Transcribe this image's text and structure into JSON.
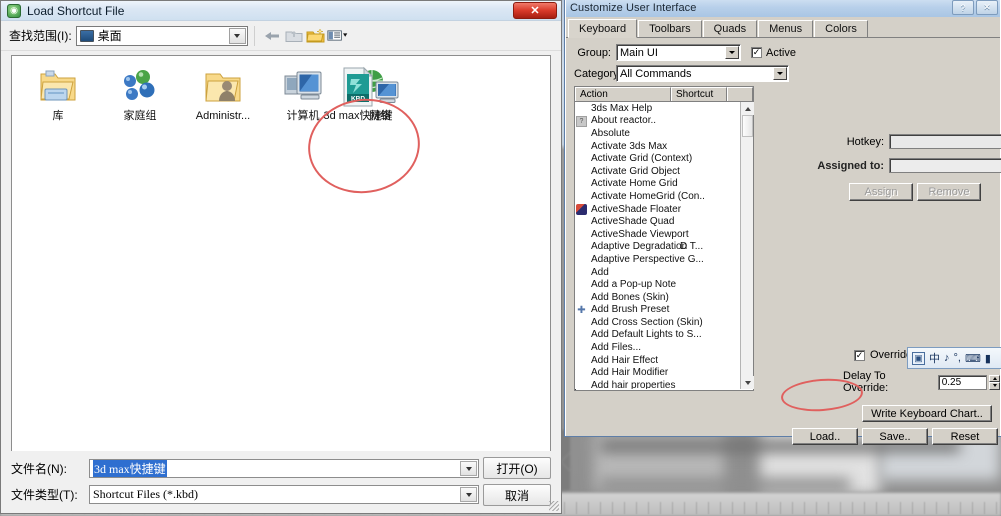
{
  "load_dialog": {
    "title": "Load Shortcut File",
    "title_icon": "max-app-icon",
    "close_label": "✕",
    "lookin_label": "查找范围(I):",
    "lookin_value": "桌面",
    "toolbar_icons": [
      "back-arrow-icon",
      "up-folder-icon",
      "new-folder-icon",
      "views-icon"
    ],
    "files": [
      {
        "label": "库",
        "icon": "library-folder-icon"
      },
      {
        "label": "家庭组",
        "icon": "homegroup-icon"
      },
      {
        "label": "Administr...",
        "icon": "user-folder-icon"
      },
      {
        "label": "计算机",
        "icon": "computer-icon"
      },
      {
        "label": "网络",
        "icon": "network-icon"
      },
      {
        "label": "3d max快捷键",
        "icon": "kbd-file-icon",
        "icon_text": "KBD"
      }
    ],
    "filename_label": "文件名(N):",
    "filename_value": "3d max快捷键",
    "filetype_label": "文件类型(T):",
    "filetype_value": "Shortcut Files (*.kbd)",
    "open_label": "打开(O)",
    "cancel_label": "取消"
  },
  "cui_window": {
    "title": "Customize User Interface",
    "help_label": "?",
    "close_label": "✕",
    "tabs": [
      {
        "label": "Keyboard",
        "active": true
      },
      {
        "label": "Toolbars",
        "active": false
      },
      {
        "label": "Quads",
        "active": false
      },
      {
        "label": "Menus",
        "active": false
      },
      {
        "label": "Colors",
        "active": false
      }
    ],
    "group_label": "Group:",
    "group_value": "Main UI",
    "active_checkbox_label": "Active",
    "active_checked": true,
    "category_label": "Category:",
    "category_value": "All Commands",
    "columns": {
      "action": "Action",
      "shortcut": "Shortcut"
    },
    "actions": [
      {
        "name": "3ds Max Help",
        "shortcut": "",
        "icon": ""
      },
      {
        "name": "About reactor..",
        "shortcut": "",
        "icon": "reactor"
      },
      {
        "name": "Absolute",
        "shortcut": "",
        "icon": ""
      },
      {
        "name": "Activate 3ds Max",
        "shortcut": "",
        "icon": ""
      },
      {
        "name": "Activate Grid (Context)",
        "shortcut": "",
        "icon": ""
      },
      {
        "name": "Activate Grid Object",
        "shortcut": "",
        "icon": ""
      },
      {
        "name": "Activate Home Grid",
        "shortcut": "",
        "icon": ""
      },
      {
        "name": "Activate HomeGrid (Con..",
        "shortcut": "",
        "icon": ""
      },
      {
        "name": "ActiveShade Floater",
        "shortcut": "",
        "icon": "shade"
      },
      {
        "name": "ActiveShade Quad",
        "shortcut": "",
        "icon": ""
      },
      {
        "name": "ActiveShade Viewport",
        "shortcut": "",
        "icon": ""
      },
      {
        "name": "Adaptive Degradation T...",
        "shortcut": "D",
        "icon": ""
      },
      {
        "name": "Adaptive Perspective G...",
        "shortcut": "",
        "icon": ""
      },
      {
        "name": "Add",
        "shortcut": "",
        "icon": ""
      },
      {
        "name": "Add a Pop-up Note",
        "shortcut": "",
        "icon": ""
      },
      {
        "name": "Add Bones (Skin)",
        "shortcut": "",
        "icon": ""
      },
      {
        "name": "Add Brush Preset",
        "shortcut": "",
        "icon": "brush"
      },
      {
        "name": "Add Cross Section (Skin)",
        "shortcut": "",
        "icon": ""
      },
      {
        "name": "Add Default Lights to S...",
        "shortcut": "",
        "icon": ""
      },
      {
        "name": "Add Files...",
        "shortcut": "",
        "icon": ""
      },
      {
        "name": "Add Hair Effect",
        "shortcut": "",
        "icon": ""
      },
      {
        "name": "Add Hair Modifier",
        "shortcut": "",
        "icon": ""
      },
      {
        "name": "Add hair properties",
        "shortcut": "",
        "icon": ""
      }
    ],
    "hotkey_label": "Hotkey:",
    "hotkey_value": "",
    "assigned_to_label": "Assigned to:",
    "assigned_to_value": "",
    "assign_label": "Assign",
    "remove_label": "Remove",
    "overrides_active_label": "Overrides Active",
    "overrides_active_checked": true,
    "delay_label": "Delay To Override:",
    "delay_value": "0.25",
    "write_chart_label": "Write Keyboard Chart..",
    "load_label": "Load..",
    "save_label": "Save..",
    "reset_label": "Reset"
  },
  "ime_bar": {
    "logo": "ime-logo-icon",
    "items": [
      "中",
      "♪",
      "°,",
      "⌨",
      "▮"
    ]
  },
  "colors": {
    "accent_red": "#e0605e",
    "titlebar_blue": "#cfe0f2",
    "dialog_face": "#d4d0c8",
    "selection_blue": "#2f6fd0"
  }
}
